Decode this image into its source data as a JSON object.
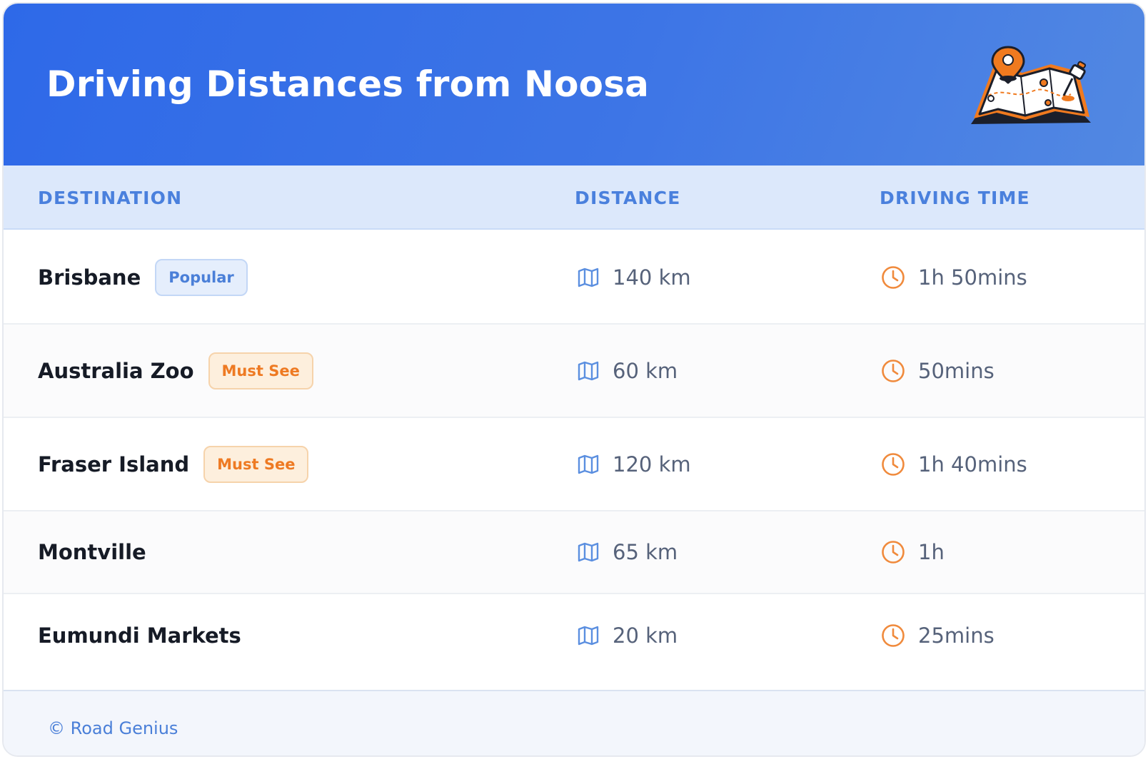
{
  "header": {
    "title": "Driving Distances from Noosa",
    "illustration": "map-pin-icon"
  },
  "columns": {
    "destination": "DESTINATION",
    "distance": "DISTANCE",
    "driving_time": "DRIVING TIME"
  },
  "rows": [
    {
      "destination": "Brisbane",
      "badge": "Popular",
      "badge_style": "blue",
      "distance": "140 km",
      "time": "1h 50mins"
    },
    {
      "destination": "Australia Zoo",
      "badge": "Must See",
      "badge_style": "orange",
      "distance": "60 km",
      "time": "50mins"
    },
    {
      "destination": "Fraser Island",
      "badge": "Must See",
      "badge_style": "orange",
      "distance": "120 km",
      "time": "1h 40mins"
    },
    {
      "destination": "Montville",
      "badge": "",
      "badge_style": "",
      "distance": "65 km",
      "time": "1h"
    },
    {
      "destination": "Eumundi Markets",
      "badge": "",
      "badge_style": "",
      "distance": "20 km",
      "time": "25mins"
    }
  ],
  "icons": {
    "distance": "map-icon",
    "time": "clock-icon"
  },
  "footer": {
    "copyright": "© Road Genius"
  },
  "colors": {
    "header_start": "#2e69e8",
    "header_end": "#5288e2",
    "column_header_bg": "#dce8fb",
    "column_header_text": "#4a80dd",
    "accent_orange": "#ee7a23",
    "accent_blue": "#4a7fd8"
  }
}
